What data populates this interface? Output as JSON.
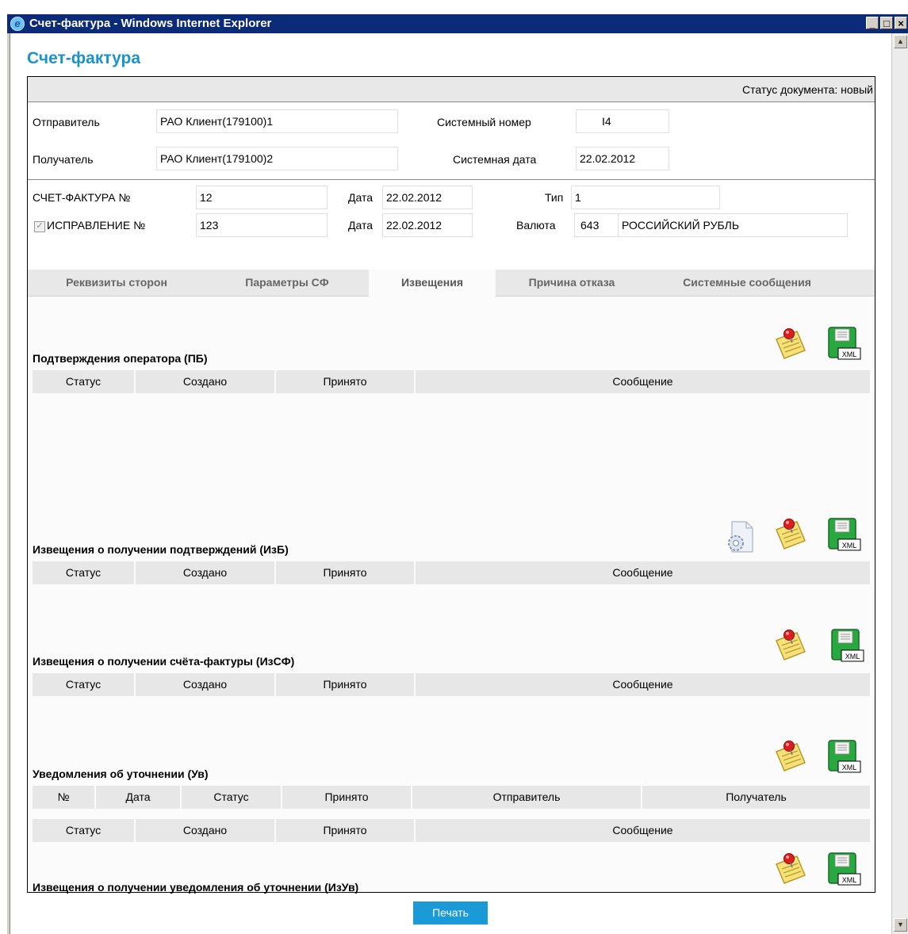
{
  "window": {
    "title": "Счет-фактура - Windows Internet Explorer",
    "ie_glyph": "e",
    "min": "_",
    "max": "□",
    "close": "×"
  },
  "page": {
    "title": "Счет-фактура"
  },
  "status": {
    "text": "Статус документа: новый"
  },
  "header": {
    "sender_label": "Отправитель",
    "sender": "РАО Клиент(179100)1",
    "receiver_label": "Получатель",
    "receiver": "РАО Клиент(179100)2",
    "sysnum_label": "Системный номер",
    "sysnum": "I4",
    "sysdate_label": "Системная дата",
    "sysdate": "22.02.2012"
  },
  "invoice": {
    "num_label": "СЧЕТ-ФАКТУРА №",
    "num": "12",
    "date_label": "Дата",
    "date": "22.02.2012",
    "type_label": "Тип",
    "type": "1",
    "corr_label": "ИСПРАВЛЕНИЕ №",
    "corr": "123",
    "corr_checked": true,
    "corr_date_label": "Дата",
    "corr_date": "22.02.2012",
    "currency_label": "Валюта",
    "currency_code": "643",
    "currency_name": "РОССИЙСКИЙ РУБЛЬ"
  },
  "tabs": [
    "Реквизиты сторон",
    "Параметры СФ",
    "Извещения",
    "Причина отказа",
    "Системные сообщения"
  ],
  "active_tab": 2,
  "sections": [
    {
      "title": "Подтверждения оператора (ПБ)",
      "columns": [
        "Статус",
        "Создано",
        "Принято",
        "Сообщение"
      ]
    },
    {
      "title": "Извещения о получении подтверждений (ИзБ)",
      "columns": [
        "Статус",
        "Создано",
        "Принято",
        "Сообщение"
      ]
    },
    {
      "title": "Извещения о получении счёта-фактуры (ИзСФ)",
      "columns": [
        "Статус",
        "Создано",
        "Принято",
        "Сообщение"
      ]
    },
    {
      "title": "Уведомления об уточнении (Ув)",
      "columns": [
        "№",
        "Дата",
        "Статус",
        "Принято",
        "Отправитель",
        "Получатель"
      ]
    },
    {
      "title": "Извещения о получении уведомления об уточнении (ИзУв)",
      "columns": [
        "Статус",
        "Создано",
        "Принято",
        "Сообщение"
      ]
    }
  ],
  "icons": {
    "xml_label": "XML",
    "note": "sign-note-icon",
    "save": "xml-save-icon",
    "settings": "settings-document-icon"
  },
  "print_button": "Печать",
  "colors": {
    "accent": "#1a93c8",
    "button": "#1a9ad6",
    "titlebar": "#0b2a78"
  }
}
